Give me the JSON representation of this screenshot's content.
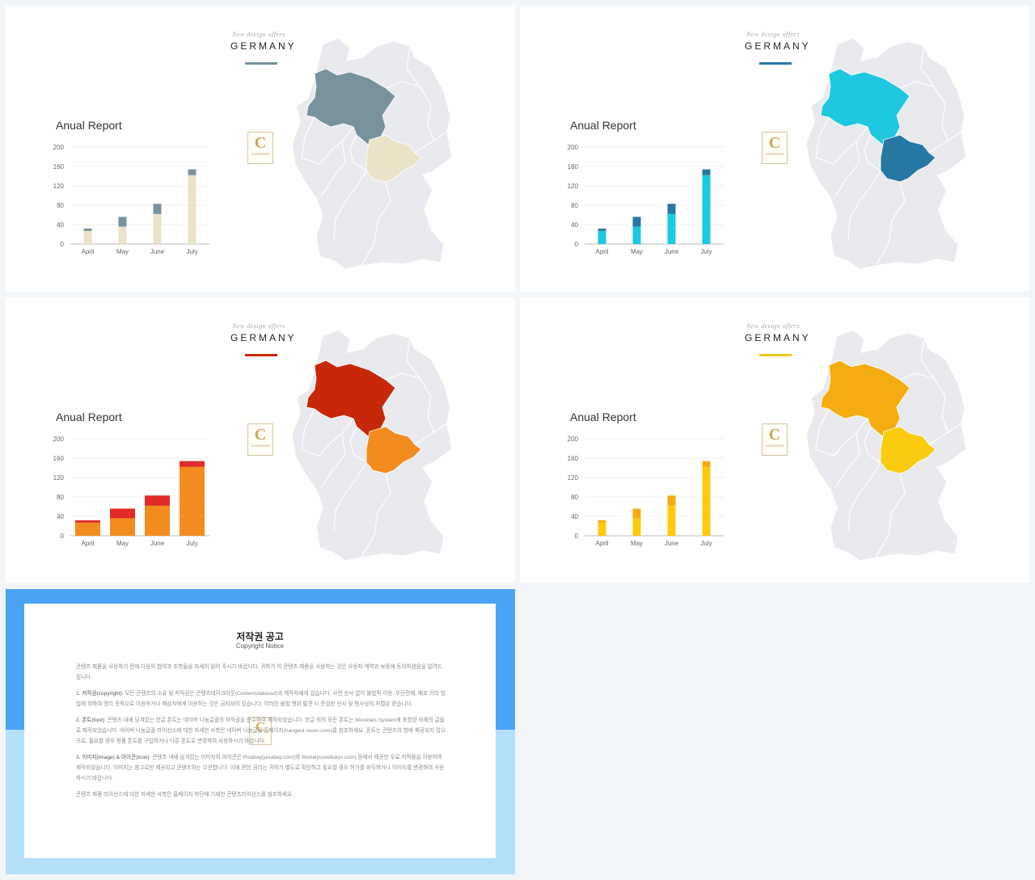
{
  "colors": {
    "page_bg": "#f2f6f8",
    "map_base": "#e9eaee",
    "map_stroke": "#ffffff"
  },
  "slides": [
    {
      "subtitle": "New design offers",
      "country": "GERMANY",
      "logo": {
        "letter": "C",
        "text": "CONTENTS"
      },
      "theme": {
        "accent": "#78929e",
        "bar_lower": "#ebe3c8",
        "bar_upper": "#78929e",
        "region_north": "#78929e",
        "region_south": "#ebe3c8"
      },
      "chart_data": {
        "type": "bar",
        "title": "Anual Report",
        "categories": [
          "April",
          "May",
          "June",
          "July"
        ],
        "series": [
          {
            "values": [
              27,
              36,
              62,
              142
            ]
          },
          {
            "values": [
              5,
              20,
              21,
              12
            ]
          }
        ],
        "ylim": [
          0,
          200
        ],
        "yticks": [
          0,
          40,
          80,
          120,
          160,
          200
        ],
        "grid": true
      }
    },
    {
      "subtitle": "New design offers",
      "country": "GERMANY",
      "logo": {
        "letter": "C",
        "text": "CONTENTS"
      },
      "theme": {
        "accent": "#2878a4",
        "bar_lower": "#1ec8df",
        "bar_upper": "#2878a4",
        "region_north": "#1ec8df",
        "region_south": "#2878a4"
      },
      "chart_data": {
        "type": "bar",
        "title": "Anual Report",
        "categories": [
          "April",
          "May",
          "June",
          "July"
        ],
        "series": [
          {
            "values": [
              27,
              36,
              62,
              142
            ]
          },
          {
            "values": [
              5,
              20,
              21,
              12
            ]
          }
        ],
        "ylim": [
          0,
          200
        ],
        "yticks": [
          0,
          40,
          80,
          120,
          160,
          200
        ],
        "grid": true
      }
    },
    {
      "subtitle": "New design offers",
      "country": "GERMANY",
      "logo": {
        "letter": "C",
        "text": "CONTENTS"
      },
      "theme": {
        "accent": "#c8280a",
        "bar_lower": "#f28c1f",
        "bar_upper": "#e22a28",
        "region_north": "#c8280a",
        "region_south": "#f28c1f"
      },
      "chart_data": {
        "type": "bar",
        "title": "Anual Report",
        "categories": [
          "April",
          "May",
          "June",
          "July"
        ],
        "series": [
          {
            "values": [
              27,
              36,
              62,
              142
            ]
          },
          {
            "values": [
              5,
              20,
              21,
              12
            ]
          }
        ],
        "ylim": [
          0,
          200
        ],
        "yticks": [
          0,
          40,
          80,
          120,
          160,
          200
        ],
        "grid": true
      }
    },
    {
      "subtitle": "New design offers",
      "country": "GERMANY",
      "logo": {
        "letter": "C",
        "text": "CONTENTS"
      },
      "theme": {
        "accent": "#f5c61c",
        "bar_lower": "#fbcb10",
        "bar_upper": "#f5ac12",
        "region_north": "#f5ac12",
        "region_south": "#fbcb10"
      },
      "chart_data": {
        "type": "bar",
        "title": "Anual Report",
        "categories": [
          "April",
          "May",
          "June",
          "July"
        ],
        "series": [
          {
            "values": [
              27,
              36,
              62,
              142
            ]
          },
          {
            "values": [
              5,
              20,
              21,
              12
            ]
          }
        ],
        "ylim": [
          0,
          200
        ],
        "yticks": [
          0,
          40,
          80,
          120,
          160,
          200
        ],
        "grid": true
      }
    }
  ],
  "notice": {
    "title": "저작권 공고",
    "subtitle": "Copyright Notice",
    "logo_letter": "C",
    "colors": {
      "top": "#4aa3f5",
      "bottom": "#b4e0fb"
    },
    "intro": "콘텐츠 제품을 사용하기 전에 다음의 협약과 조항들을 자세히 읽어 주시기 바랍니다. 귀하가 이 콘텐츠 제품을 사용하는 것은 사용자 계약과 보증에 동의하셨음을 알려드립니다.",
    "p1_head": "1. 저작권(copyright):",
    "p1": "모든 콘텐츠의 소유 및 저작권은 콘텐츠테이크아웃(Contentstakeout)과 제작자에게 있습니다. 사전 승낙 없이 불법적 이용, 무단전재, 배포 기타 방법에 의하여 영리 목적으로 이용하거나 제삼자에게 이용하는 것은 금지되어 있습니다. 이러한 불법 행위 발견 시 준엄한 민사 및 형사상의 처벌을 받습니다.",
    "p2_head": "2. 폰트(font):",
    "p2": "콘텐츠 내에 담겨있는 한글 폰트는 네이버 나눔글꼴의 저작권을 준수하여 제작되었습니다. 한글 외의 모든 폰트는 Windows System에 포함된 자체의 글꼴로 제작되었습니다. 네이버 나눔글꼴 라이선스에 대한 자세한 사항은 네이버 나눔글꼴 홈페이지(hangeul.naver.com)를 참조하세요. 폰트는 콘텐츠의 항에 제공되지 않으므로, 필요할 경우 정품 폰트를 구입하거나 다른 폰트로 변경하여 사용하시기 바랍니다.",
    "p3_head": "3. 이미지(image) & 아이콘(icon):",
    "p3": "콘텐츠 내에 담겨있는 이미지와 아이콘은 Pixabay(pixabay.com)와 Webalys(webalys.com) 등에서 제공한 무료 저작물을 이용하여 제작되었습니다. 이미지는 참고로만 제공되고 콘텐츠와는 무관합니다. 이에 관한 권리는 귀하가 별도로 확인하고 필요할 경우 허가를 취득하거나 이미지를 변경하여 사용하시기 바랍니다.",
    "closing": "콘텐츠 제품 라이선스에 대한 자세한 사항은 홈페이지 하단에 기재한 콘텐츠라이선스를 참조하세요."
  }
}
